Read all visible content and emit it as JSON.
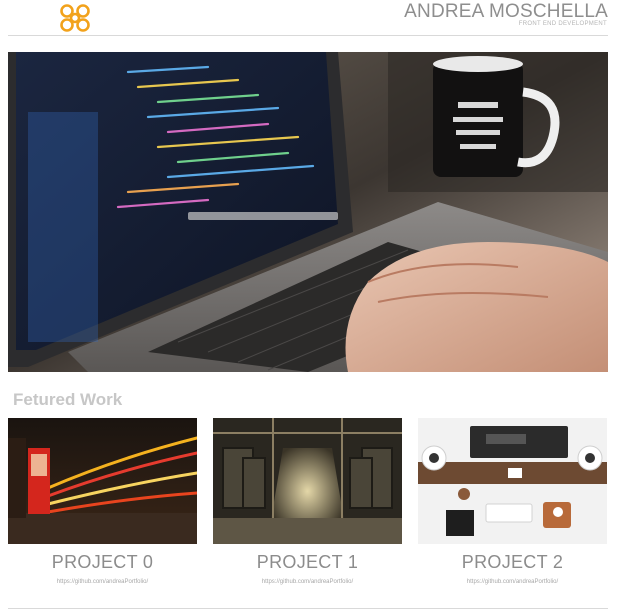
{
  "header": {
    "name": "ANDREA MOSCHELLA",
    "tagline": "FRONT END DEVELOPMENT",
    "logo_icon": "orange-knot-logo",
    "accent": "#f2a21b"
  },
  "hero": {
    "image": "laptop-coding-photo"
  },
  "featured": {
    "title": "Fetured Work",
    "projects": [
      {
        "title": "PROJECT 0",
        "link": "https://github.com/andreaPortfolio/",
        "image": "london-phone-booth-photo"
      },
      {
        "title": "PROJECT 1",
        "link": "https://github.com/andreaPortfolio/",
        "image": "train-interior-photo"
      },
      {
        "title": "PROJECT 2",
        "link": "https://github.com/andreaPortfolio/",
        "image": "desk-workspace-photo"
      }
    ]
  }
}
